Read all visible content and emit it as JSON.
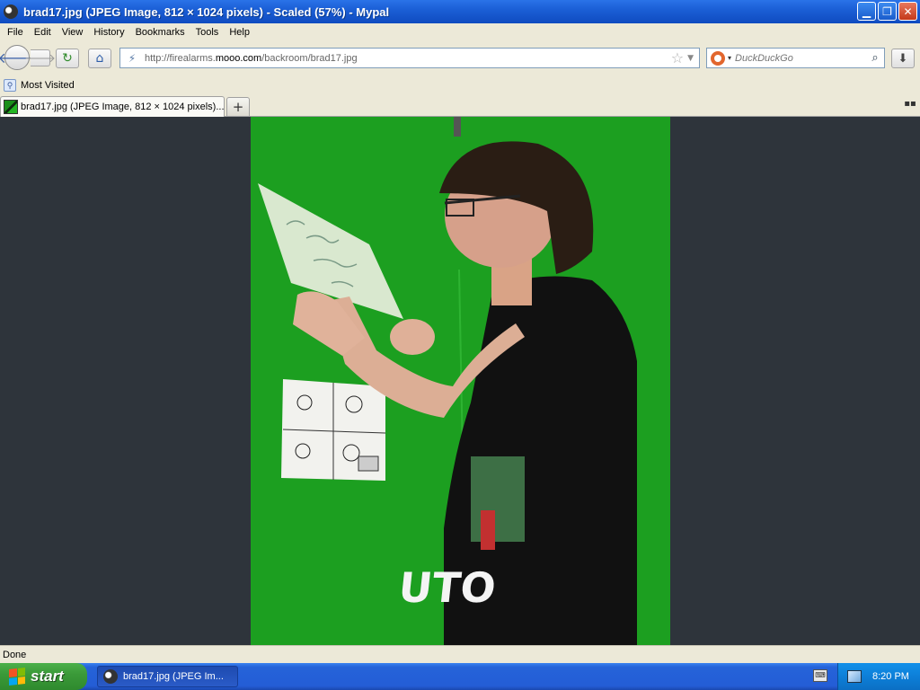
{
  "window": {
    "title": "brad17.jpg (JPEG Image, 812 × 1024 pixels) - Scaled (57%) - Mypal",
    "minimize_label": "▁",
    "restore_label": "❐",
    "close_label": "✕"
  },
  "menu": [
    "File",
    "Edit",
    "View",
    "History",
    "Bookmarks",
    "Tools",
    "Help"
  ],
  "nav": {
    "url_prefix": "http://firealarms.",
    "url_domain": "mooo.com",
    "url_path": "/backroom/brad17.jpg",
    "search_placeholder": "DuckDuckGo"
  },
  "bookmarks": [
    "Most Visited"
  ],
  "tab": {
    "label": "brad17.jpg (JPEG Image, 812 × 1024 pixels)..."
  },
  "status": {
    "text": "Done"
  },
  "taskbar": {
    "start_label": "start",
    "task_label": "brad17.jpg (JPEG Im...",
    "clock": "8:20 PM"
  },
  "colors": {
    "titlebar": "#1b5fd6",
    "content_bg": "#2e343b",
    "photo_bg": "#1fa824",
    "taskbar": "#245dd6",
    "start_button": "#3b9a39"
  },
  "icons": [
    "app-icon",
    "back-arrow-icon",
    "forward-arrow-icon",
    "reload-icon",
    "home-icon",
    "site-identity-icon",
    "star-icon",
    "dropmarker-icon",
    "search-engine-icon",
    "search-icon",
    "download-icon",
    "bookmark-folder-icon",
    "favicon",
    "new-tab-icon",
    "tab-list-icon",
    "windows-flag-icon",
    "keyboard-icon",
    "network-icon"
  ]
}
